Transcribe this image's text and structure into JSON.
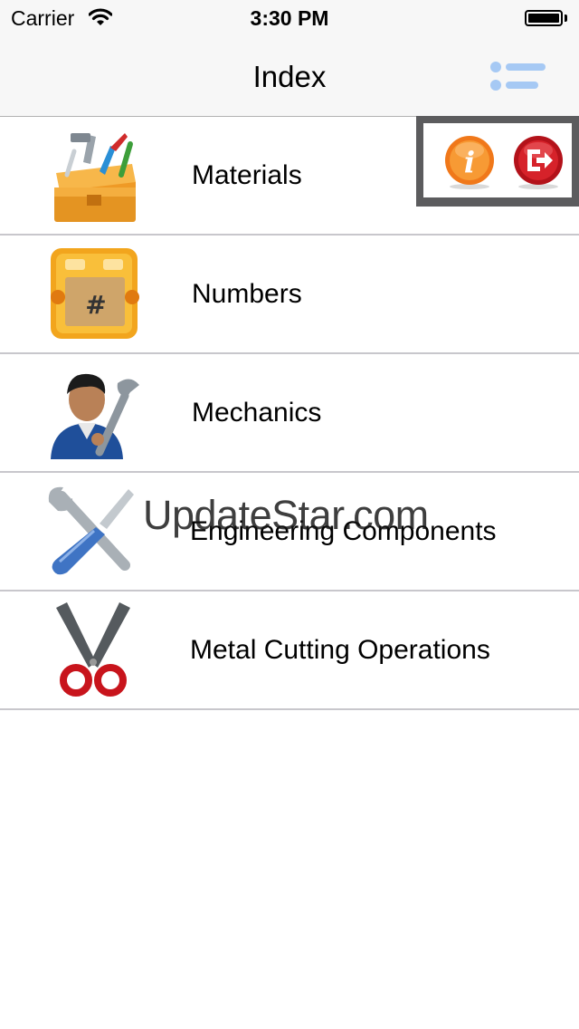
{
  "status": {
    "carrier": "Carrier",
    "time": "3:30 PM"
  },
  "nav": {
    "title": "Index"
  },
  "items": [
    {
      "label": "Materials",
      "icon": "toolbox-icon"
    },
    {
      "label": "Numbers",
      "icon": "number-sign-icon"
    },
    {
      "label": "Mechanics",
      "icon": "mechanic-person-icon"
    },
    {
      "label": "Engineering Components",
      "icon": "wrench-screwdriver-icon"
    },
    {
      "label": "Metal Cutting Operations",
      "icon": "scissors-icon"
    }
  ],
  "watermark": "UpdateStar.com",
  "colors": {
    "accent": "#007aff",
    "info": "#f0781a",
    "exit": "#c8181e"
  }
}
